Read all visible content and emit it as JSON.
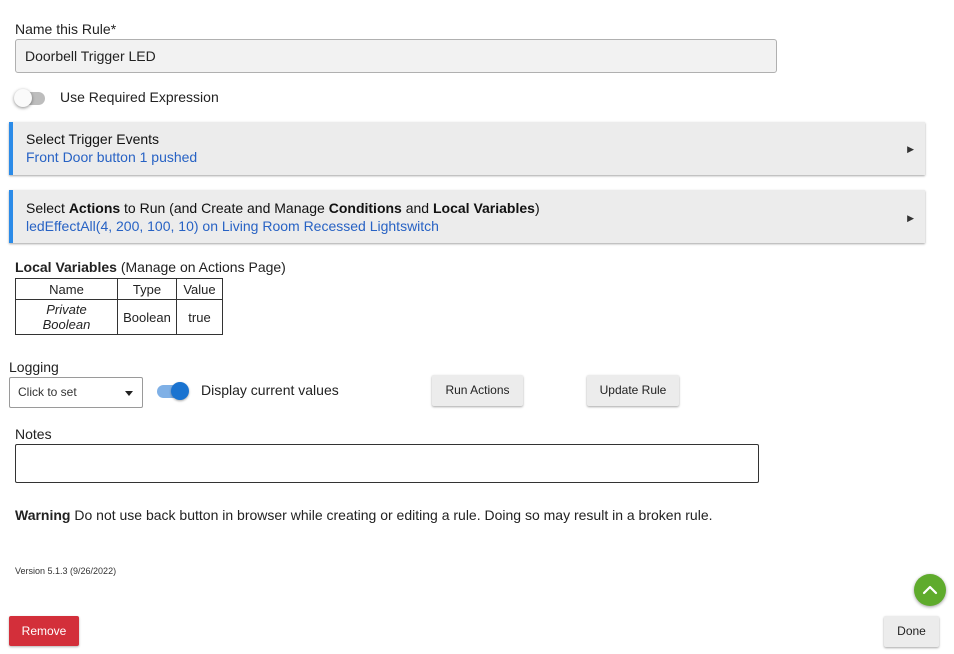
{
  "rule_name": {
    "label": "Name this Rule*",
    "value": "Doorbell Trigger LED"
  },
  "required_expression": {
    "label": "Use Required Expression",
    "enabled": false
  },
  "trigger_panel": {
    "title": "Select Trigger Events",
    "summary": "Front Door button 1 pushed",
    "expand_icon": "triangle-right"
  },
  "actions_panel": {
    "title_parts": [
      "Select ",
      "Actions",
      " to Run (and Create and Manage ",
      "Conditions",
      " and ",
      "Local Variables",
      ")"
    ],
    "summary": "ledEffectAll(4, 200, 100, 10) on Living Room Recessed Lightswitch",
    "expand_icon": "triangle-right"
  },
  "local_variables": {
    "heading": "Local Variables",
    "note": " (Manage on Actions Page)",
    "columns": [
      "Name",
      "Type",
      "Value"
    ],
    "rows": [
      {
        "name": "Private Boolean",
        "type": "Boolean",
        "value": "true"
      }
    ]
  },
  "logging": {
    "label": "Logging",
    "placeholder": "Click to set"
  },
  "display_values": {
    "label": "Display current values",
    "enabled": true
  },
  "buttons": {
    "run_actions": "Run Actions",
    "update_rule": "Update Rule",
    "remove": "Remove",
    "done": "Done"
  },
  "notes": {
    "label": "Notes",
    "value": ""
  },
  "warning": {
    "bold": "Warning",
    "text": " Do not use back button in browser while creating or editing a rule. Doing so may result in a broken rule."
  },
  "version": "Version 5.1.3 (9/26/2022)",
  "colors": {
    "accent": "#2b8be8",
    "link": "#2762c4",
    "remove": "#d32f3a",
    "fab": "#5fab2c",
    "toggle_on": "#1a73d0"
  },
  "icons": {
    "scroll_top": "chevron-up-icon"
  }
}
